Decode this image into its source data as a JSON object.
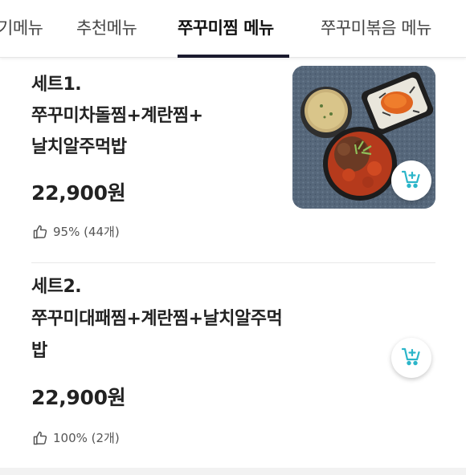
{
  "tabs": [
    {
      "label": "기메뉴",
      "active": false
    },
    {
      "label": "추천메뉴",
      "active": false
    },
    {
      "label": "쭈꾸미찜 메뉴",
      "active": true
    },
    {
      "label": "쭈꾸미볶음 메뉴",
      "active": false
    }
  ],
  "items": [
    {
      "title_lines": [
        "세트1.",
        "쭈꾸미차돌찜+계란찜+",
        "날치알주먹밥"
      ],
      "price": "22,900원",
      "rating": "95% (44개)"
    },
    {
      "title_lines": [
        "세트2.",
        "쭈꾸미대패찜+계란찜+날치알주먹",
        "밥"
      ],
      "price": "22,900원",
      "rating": "100% (2개)"
    }
  ],
  "icons": {
    "thumbs_up": "thumbs-up-icon",
    "cart": "cart-add-icon"
  },
  "colors": {
    "accent_cart": "#2bb5c9",
    "tab_indicator": "#1a1a2e"
  }
}
